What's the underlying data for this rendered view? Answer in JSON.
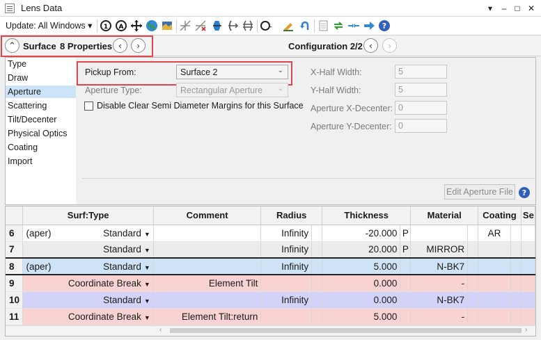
{
  "window": {
    "title": "Lens Data",
    "minimize": "–",
    "maximize": "□",
    "close": "✕",
    "menu": "▾"
  },
  "toolbar": {
    "update_label": "Update: All Windows ▾"
  },
  "surface_bar": {
    "surface_label": "Surface",
    "properties_label": "8 Properties",
    "configuration_label": "Configuration 2/2"
  },
  "categories": [
    "Type",
    "Draw",
    "Aperture",
    "Scattering",
    "Tilt/Decenter",
    "Physical Optics",
    "Coating",
    "Import"
  ],
  "aperture": {
    "pickup_label": "Pickup From:",
    "pickup_value": "Surface 2",
    "aperture_type_label": "Aperture Type:",
    "aperture_type_value": "Rectangular Aperture",
    "disable_margins_label": "Disable Clear Semi Diameter Margins for this Surface",
    "x_half_width_label": "X-Half Width:",
    "x_half_width_value": "5",
    "y_half_width_label": "Y-Half Width:",
    "y_half_width_value": "5",
    "x_decenter_label": "Aperture X-Decenter:",
    "x_decenter_value": "0",
    "y_decenter_label": "Aperture Y-Decenter:",
    "y_decenter_value": "0",
    "edit_button": "Edit Aperture File",
    "help_icon": "?"
  },
  "table": {
    "columns": [
      "Surf:Type",
      "Comment",
      "Radius",
      "Thickness",
      "Material",
      "Coating",
      "Se"
    ],
    "rows": [
      {
        "num": "6",
        "aper": "(aper)",
        "type": "Standard",
        "comment": "",
        "radius": "Infinity",
        "thickness": "-20.000",
        "solve": "P",
        "material": "",
        "coating": "AR",
        "style": "white"
      },
      {
        "num": "7",
        "aper": "",
        "type": "Standard",
        "comment": "",
        "radius": "Infinity",
        "thickness": "20.000",
        "solve": "P",
        "material": "MIRROR",
        "coating": "",
        "style": "gray"
      },
      {
        "num": "8",
        "aper": "(aper)",
        "type": "Standard",
        "comment": "",
        "radius": "Infinity",
        "thickness": "5.000",
        "solve": "",
        "material": "N-BK7",
        "coating": "",
        "style": "sel"
      },
      {
        "num": "9",
        "aper": "",
        "type": "Coordinate Break",
        "comment": "Element Tilt",
        "radius": "",
        "thickness": "0.000",
        "solve": "",
        "material": "-",
        "coating": "",
        "style": "pink"
      },
      {
        "num": "10",
        "aper": "",
        "type": "Standard",
        "comment": "",
        "radius": "Infinity",
        "thickness": "0.000",
        "solve": "",
        "material": "N-BK7",
        "coating": "",
        "style": "violet"
      },
      {
        "num": "11",
        "aper": "",
        "type": "Coordinate Break",
        "comment": "Element Tilt:return",
        "radius": "",
        "thickness": "5.000",
        "solve": "",
        "material": "-",
        "coating": "",
        "style": "pink"
      }
    ]
  },
  "colors": {
    "highlight_red": "#e0454a",
    "selection_blue": "#cde3f7",
    "row_pink": "#f9d2d2",
    "row_violet": "#d3d3f9"
  }
}
